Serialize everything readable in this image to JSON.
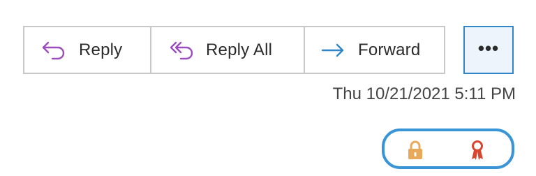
{
  "actions": {
    "reply": {
      "label": "Reply",
      "icon": "reply-arrow-icon"
    },
    "reply_all": {
      "label": "Reply All",
      "icon": "reply-all-arrows-icon"
    },
    "forward": {
      "label": "Forward",
      "icon": "forward-arrow-icon"
    },
    "more": {
      "label": "•••",
      "icon": "ellipsis-icon"
    }
  },
  "message": {
    "timestamp": "Thu 10/21/2021 5:11 PM"
  },
  "security": {
    "encrypted_icon": "padlock-icon",
    "signed_icon": "digital-signature-ribbon-icon"
  },
  "colors": {
    "reply_icon": "#9b4dbd",
    "forward_icon": "#2f86c9",
    "more_border": "#2f86c9",
    "lock": "#e8a95a",
    "ribbon": "#d9462f",
    "highlight_ring": "#3a95d6"
  }
}
